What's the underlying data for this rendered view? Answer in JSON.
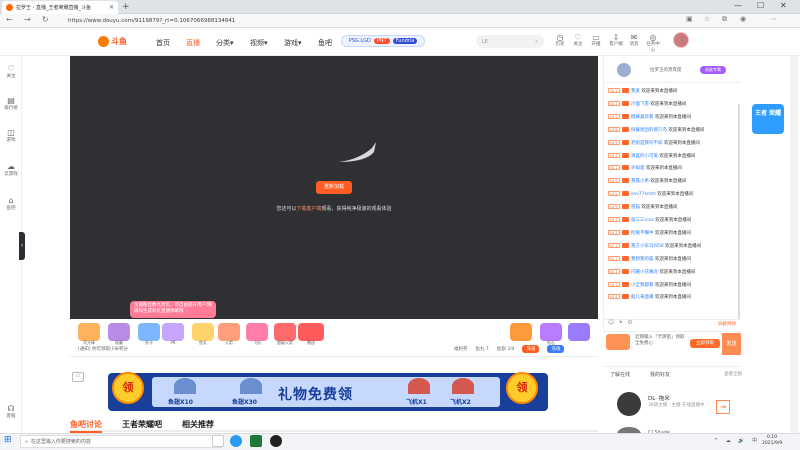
{
  "browser": {
    "tab_title": "拉罗王 - 直播_王者荣耀直播_斗鱼",
    "url": "https://www.douyu.com/9119879?_rt=0.1067066988134841",
    "new_tab": "+",
    "minimize": "—",
    "restore": "☐",
    "close": "✕"
  },
  "header": {
    "logo": "斗鱼",
    "nav": [
      "首页",
      "直播",
      "分类▾",
      "视频▾",
      "游戏▾",
      "鱼吧"
    ],
    "lpl": {
      "left": "PSG.LGD",
      "mid": "PNT",
      "right": "Fundria"
    },
    "search_placeholder": "LE",
    "icons": [
      {
        "label": "历史",
        "icon": "clock-icon"
      },
      {
        "label": "关注",
        "icon": "heart-icon"
      },
      {
        "label": "开播",
        "icon": "camera-icon"
      },
      {
        "label": "客户端",
        "icon": "download-icon"
      },
      {
        "label": "消息",
        "icon": "mail-icon"
      },
      {
        "label": "任务中心",
        "icon": "task-icon"
      }
    ]
  },
  "leftbar": [
    {
      "label": "关注",
      "icon": "heart-icon"
    },
    {
      "label": "排行榜",
      "icon": "rank-icon"
    },
    {
      "label": "游戏",
      "icon": "gamepad-icon"
    },
    {
      "label": "云游戏",
      "icon": "cloud-icon"
    },
    {
      "label": "鱼吧",
      "icon": "fish-icon"
    },
    {
      "label": "客服",
      "icon": "headset-icon"
    }
  ],
  "player": {
    "reload": "重新加载",
    "hint_pre": "您还可以",
    "hint_link": "下载客户端",
    "hint_post": "观看，获得纯净极速的观看体验",
    "popup": "主播粉丝数九周年，可自由提升用户等级和生成彩虹直播弹幕哦",
    "popup_close": "×"
  },
  "gifts": [
    "荧光棒",
    "稳赢",
    "办卡",
    "PK",
    "鱼丸",
    "火箭",
    "飞机",
    "超级火箭",
    "赠送",
    "钻石"
  ],
  "room": {
    "info": "[通知] 你可领取小米积分",
    "stats": [
      "福利券",
      "鱼丸 7",
      "鱼翅 3/4"
    ],
    "charge": "充值",
    "pay": "充值"
  },
  "banner": {
    "title": "礼物免费领",
    "labels": [
      "鱼翅X10",
      "鱼翅X30",
      "飞机X1",
      "飞机X2"
    ],
    "coin": "领"
  },
  "tabs": [
    "鱼吧讨论",
    "王者荣耀吧",
    "相关推荐"
  ],
  "chat": {
    "head_text": "拉罗王的贵宾席",
    "head_badge": "贵族专属",
    "messages": [
      {
        "lv": "LV 1",
        "name": "我爱",
        "text": "欢迎来到本直播间"
      },
      {
        "lv": "LV 5",
        "name": "冷面飞雪",
        "text": "欢迎来到本直播间"
      },
      {
        "lv": "LV 2",
        "name": "旭峰喜欢看",
        "text": "欢迎来到本直播间"
      },
      {
        "lv": "LV 8",
        "name": "快餐饭团的那只鸟",
        "text": "欢迎来到本直播间"
      },
      {
        "lv": "LV 3",
        "name": "老街是我吗不如",
        "text": "欢迎来到本直播间"
      },
      {
        "lv": "LV 4",
        "name": "清晨的小可爱",
        "text": "欢迎来到本直播间"
      },
      {
        "lv": "LV 1",
        "name": "许如意",
        "text": "欢迎来到本直播间"
      },
      {
        "lv": "LV 6",
        "name": "我靠小希",
        "text": "欢迎来到本直播间"
      },
      {
        "lv": "LV 2",
        "name": "sev77smth",
        "text": "欢迎来到本直播间"
      },
      {
        "lv": "LV 9",
        "name": "夜猫",
        "text": "欢迎来到本直播间"
      },
      {
        "lv": "LV 3",
        "name": "留三三nice",
        "text": "欢迎来到本直播间"
      },
      {
        "lv": "LV 5",
        "name": "挖掘不懈中",
        "text": "欢迎来到本直播间"
      },
      {
        "lv": "LV 2",
        "name": "我方小军马归58",
        "text": "欢迎来到本直播间"
      },
      {
        "lv": "LV 7",
        "name": "我想我的猫",
        "text": "欢迎来到本直播间"
      },
      {
        "lv": "LV 4",
        "name": "闪耀小花嘴龙",
        "text": "欢迎来到本直播间"
      },
      {
        "lv": "LV 1",
        "name": "小全我都看",
        "text": "欢迎来到本直播间"
      },
      {
        "lv": "LV 6",
        "name": "船儿来直播",
        "text": "欢迎来到本直播间"
      }
    ],
    "tools_right": "屏蔽特效",
    "input_text": "近期输入「卡牌密」领取全免费心",
    "input_btn": "立即领取",
    "send": "发送"
  },
  "friends": {
    "tabs": [
      "了解在线",
      "我的好友"
    ],
    "more": "查看全部",
    "name": "DL· 拖米",
    "sub": "38级主播 · 主播\n在线直播中",
    "name2": "Cl Shade"
  },
  "ad": "王者\n荣耀",
  "taskbar": {
    "search": "在这里输入你要搜索的内容",
    "time": "0:10",
    "date": "2021/9/9",
    "tray": "^ ☁ 🔊 中"
  },
  "colors": {
    "accent": "#ff5d23",
    "chat_level": "#ff6a2b",
    "nickname": "#2f7fff",
    "video_bg": "#2f3033"
  }
}
